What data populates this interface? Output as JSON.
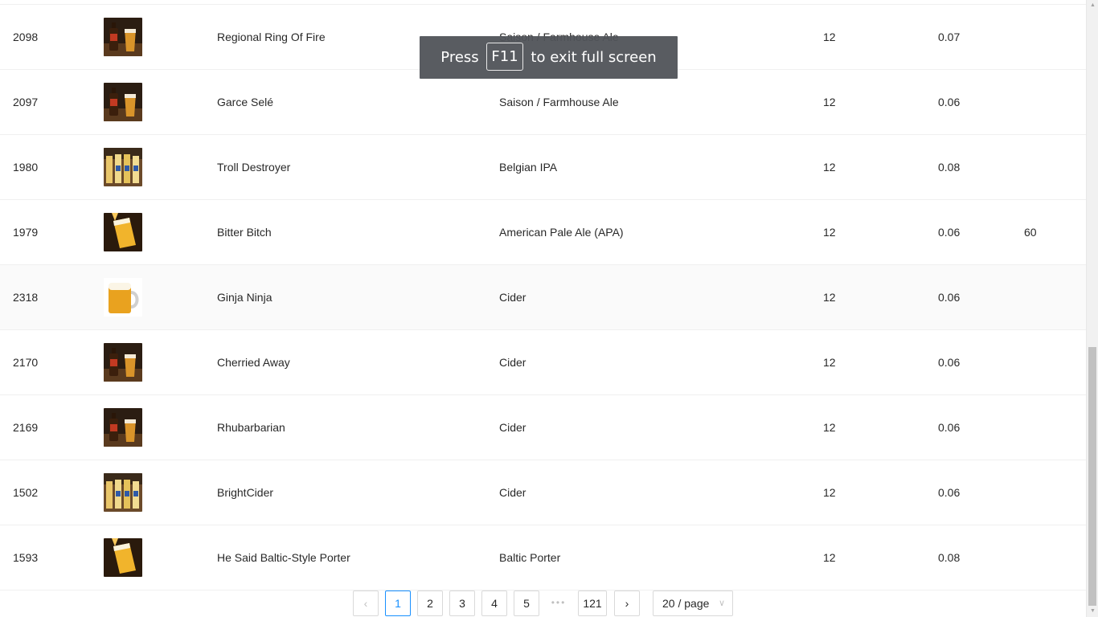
{
  "table": {
    "rows": [
      {
        "id": "2098",
        "thumb": "bottle-and-glass",
        "name": "Regional Ring Of Fire",
        "style": "Saison / Farmhouse Ale",
        "ounces": "12",
        "abv": "0.07",
        "ibu": ""
      },
      {
        "id": "2097",
        "thumb": "bottle-and-glass",
        "name": "Garce Selé",
        "style": "Saison / Farmhouse Ale",
        "ounces": "12",
        "abv": "0.06",
        "ibu": ""
      },
      {
        "id": "1980",
        "thumb": "bottles-row",
        "name": "Troll Destroyer",
        "style": "Belgian IPA",
        "ounces": "12",
        "abv": "0.08",
        "ibu": ""
      },
      {
        "id": "1979",
        "thumb": "pouring-glass",
        "name": "Bitter Bitch",
        "style": "American Pale Ale (APA)",
        "ounces": "12",
        "abv": "0.06",
        "ibu": "60"
      },
      {
        "id": "2318",
        "thumb": "beer-mug",
        "name": "Ginja Ninja",
        "style": "Cider",
        "ounces": "12",
        "abv": "0.06",
        "ibu": ""
      },
      {
        "id": "2170",
        "thumb": "bottle-and-glass",
        "name": "Cherried Away",
        "style": "Cider",
        "ounces": "12",
        "abv": "0.06",
        "ibu": ""
      },
      {
        "id": "2169",
        "thumb": "bottle-and-glass",
        "name": "Rhubarbarian",
        "style": "Cider",
        "ounces": "12",
        "abv": "0.06",
        "ibu": ""
      },
      {
        "id": "1502",
        "thumb": "bottles-row",
        "name": "BrightCider",
        "style": "Cider",
        "ounces": "12",
        "abv": "0.06",
        "ibu": ""
      },
      {
        "id": "1593",
        "thumb": "pouring-glass",
        "name": "He Said Baltic-Style Porter",
        "style": "Baltic Porter",
        "ounces": "12",
        "abv": "0.08",
        "ibu": ""
      }
    ]
  },
  "pagination": {
    "prev_icon": "chevron-left-icon",
    "next_icon": "chevron-right-icon",
    "pages": [
      "1",
      "2",
      "3",
      "4",
      "5"
    ],
    "active_page": "1",
    "ellipsis": "•••",
    "last_page": "121",
    "page_size": "20 / page",
    "page_size_icon": "chevron-down-icon"
  },
  "fullscreen_notice": {
    "before": "Press",
    "key": "F11",
    "after": "to exit full screen"
  },
  "colors": {
    "accent": "#1890ff",
    "border": "#d9d9d9",
    "row_divider": "#f0f0f0",
    "toast_bg": "#505358"
  }
}
